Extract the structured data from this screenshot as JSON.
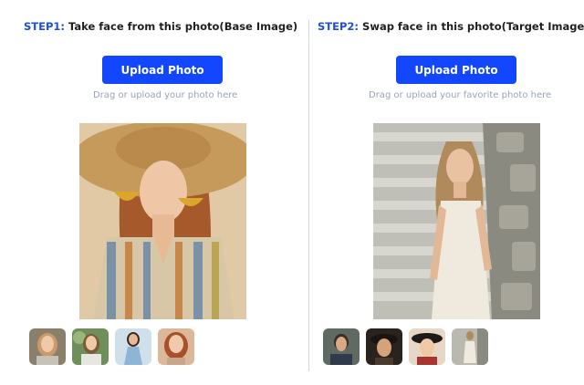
{
  "left": {
    "step_number": "STEP1:",
    "step_text": "Take face from this photo(Base Image)",
    "upload_label": "Upload Photo",
    "hint": "Drag or upload your photo here",
    "thumbnails": [
      "woman-smiling",
      "woman-in-garden",
      "woman-in-dress",
      "woman-red-hair"
    ]
  },
  "right": {
    "step_number": "STEP2:",
    "step_text": "Swap face in this photo(Target Image)",
    "upload_label": "Upload Photo",
    "hint": "Drag or upload your favorite photo here",
    "thumbnails": [
      "man-portrait",
      "man-with-hat",
      "woman-with-hat",
      "woman-full-body"
    ]
  },
  "colors": {
    "accent": "#1246ff",
    "step_number": "#1f4fd8",
    "hint_text": "#9aa3b8",
    "divider": "#cfd6e6"
  }
}
